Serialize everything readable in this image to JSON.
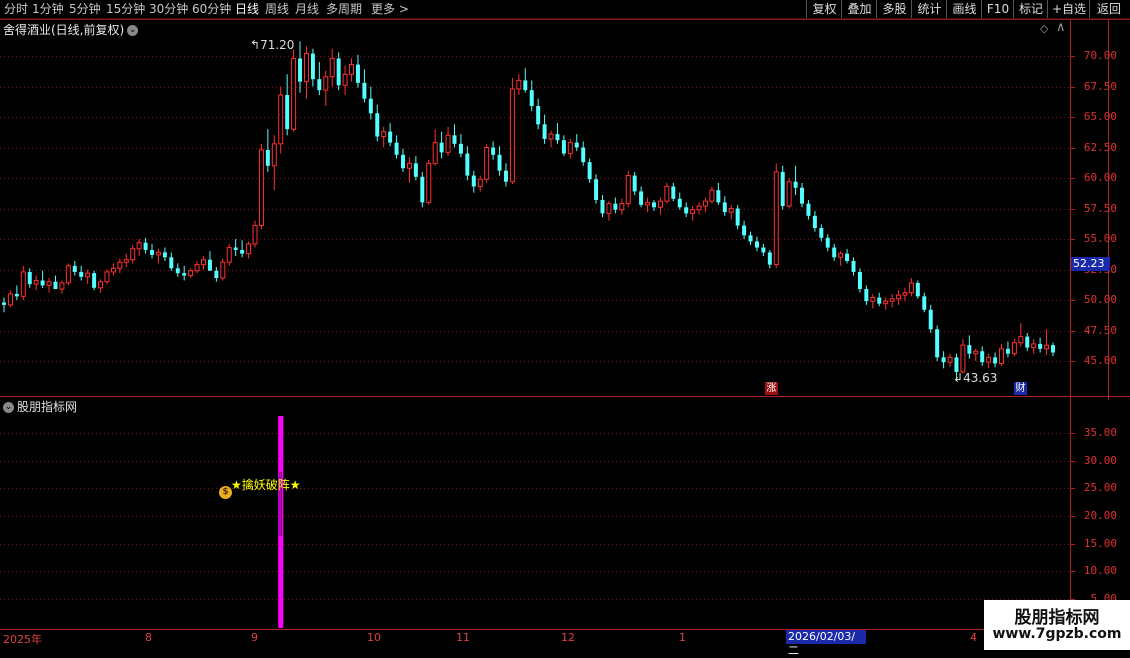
{
  "toolbar": {
    "periods": [
      "分时",
      "1分钟",
      "5分钟",
      "15分钟",
      "30分钟",
      "60分钟",
      "日线",
      "周线",
      "月线",
      "多周期",
      "更多"
    ],
    "active_period": "日线",
    "buttons": [
      "复权",
      "叠加",
      "多股",
      "统计",
      "画线",
      "F10",
      "标记",
      "+自选",
      "返回"
    ]
  },
  "main_chart": {
    "title": "舍得酒业(日线,前复权)",
    "price_labels": [
      "70.00",
      "67.50",
      "65.00",
      "62.50",
      "60.00",
      "57.50",
      "55.00",
      "52.50",
      "50.00",
      "47.50",
      "45.00"
    ],
    "current_price_tag": "52.23",
    "high_annotation": "71.20",
    "low_annotation": "43.63",
    "event_markers": [
      "涨",
      "财"
    ]
  },
  "indicator_panel": {
    "title": "股朋指标网",
    "signal_text": "★擒妖破阵★",
    "axis_labels": [
      "35.00",
      "30.00",
      "25.00",
      "20.00",
      "15.00",
      "10.00",
      "5.00"
    ]
  },
  "date_axis": {
    "labels": [
      "2025年",
      "8",
      "9",
      "10",
      "11",
      "12",
      "1",
      "4"
    ],
    "highlighted_date": "2026/02/03/二"
  },
  "watermark": {
    "name": "股朋指标网",
    "url": "www.7gpzb.com"
  },
  "colors": {
    "up": "#ff3030",
    "down": "#54ffff",
    "grid": "#7a1010",
    "signal_bar": "#ff00ff",
    "signal_text": "#ffff00"
  },
  "chart_data": {
    "type": "candlestick",
    "ylim": [
      43.0,
      72.5
    ],
    "candles": [
      [
        49.8,
        50.2,
        49.0,
        49.6
      ],
      [
        49.6,
        50.8,
        49.4,
        50.5
      ],
      [
        50.5,
        51.2,
        50.0,
        50.3
      ],
      [
        50.3,
        52.8,
        50.0,
        52.3
      ],
      [
        52.3,
        52.6,
        51.0,
        51.3
      ],
      [
        51.3,
        52.0,
        50.8,
        51.6
      ],
      [
        51.6,
        52.4,
        51.0,
        51.2
      ],
      [
        51.2,
        51.8,
        50.6,
        51.5
      ],
      [
        51.5,
        52.0,
        51.0,
        50.9
      ],
      [
        50.9,
        51.6,
        50.5,
        51.4
      ],
      [
        51.4,
        53.0,
        51.2,
        52.8
      ],
      [
        52.8,
        53.2,
        52.0,
        52.3
      ],
      [
        52.3,
        52.8,
        51.6,
        51.9
      ],
      [
        51.9,
        52.5,
        51.3,
        52.2
      ],
      [
        52.2,
        52.4,
        50.8,
        51.0
      ],
      [
        51.0,
        51.7,
        50.6,
        51.5
      ],
      [
        51.5,
        52.5,
        51.3,
        52.3
      ],
      [
        52.3,
        53.0,
        52.0,
        52.6
      ],
      [
        52.6,
        53.4,
        52.2,
        53.1
      ],
      [
        53.1,
        53.8,
        52.7,
        53.3
      ],
      [
        53.3,
        54.5,
        53.0,
        54.2
      ],
      [
        54.2,
        55.0,
        53.6,
        54.7
      ],
      [
        54.7,
        55.1,
        53.8,
        54.1
      ],
      [
        54.1,
        54.6,
        53.4,
        53.7
      ],
      [
        53.7,
        54.2,
        53.0,
        53.9
      ],
      [
        53.9,
        54.3,
        53.2,
        53.5
      ],
      [
        53.5,
        53.9,
        52.4,
        52.6
      ],
      [
        52.6,
        53.0,
        51.9,
        52.2
      ],
      [
        52.2,
        52.8,
        51.6,
        52.0
      ],
      [
        52.0,
        52.6,
        51.8,
        52.4
      ],
      [
        52.4,
        53.2,
        52.2,
        52.9
      ],
      [
        52.9,
        53.6,
        52.5,
        53.3
      ],
      [
        53.3,
        54.0,
        52.9,
        52.4
      ],
      [
        52.4,
        52.7,
        51.5,
        51.8
      ],
      [
        51.8,
        53.4,
        51.6,
        53.1
      ],
      [
        53.1,
        54.6,
        52.8,
        54.3
      ],
      [
        54.3,
        55.0,
        53.6,
        54.1
      ],
      [
        54.1,
        54.9,
        53.5,
        53.8
      ],
      [
        53.8,
        54.8,
        53.4,
        54.6
      ],
      [
        54.6,
        56.5,
        54.3,
        56.1
      ],
      [
        56.1,
        62.8,
        55.8,
        62.3
      ],
      [
        62.3,
        64.0,
        60.5,
        61.0
      ],
      [
        61.0,
        63.5,
        59.0,
        62.8
      ],
      [
        62.8,
        67.5,
        62.0,
        66.8
      ],
      [
        66.8,
        68.5,
        63.5,
        64.0
      ],
      [
        64.0,
        70.5,
        63.8,
        69.8
      ],
      [
        69.8,
        71.2,
        67.0,
        67.9
      ],
      [
        67.9,
        70.8,
        66.5,
        70.2
      ],
      [
        70.2,
        70.6,
        67.5,
        68.1
      ],
      [
        68.1,
        69.5,
        66.8,
        67.2
      ],
      [
        67.2,
        68.8,
        65.9,
        68.3
      ],
      [
        68.3,
        70.6,
        67.5,
        69.8
      ],
      [
        69.8,
        70.3,
        67.2,
        67.6
      ],
      [
        67.6,
        69.2,
        66.8,
        68.5
      ],
      [
        68.5,
        69.8,
        67.9,
        69.3
      ],
      [
        69.3,
        70.1,
        67.4,
        67.8
      ],
      [
        67.8,
        68.9,
        66.2,
        66.5
      ],
      [
        66.5,
        67.5,
        64.8,
        65.3
      ],
      [
        65.3,
        66.0,
        63.0,
        63.4
      ],
      [
        63.4,
        64.2,
        62.5,
        63.8
      ],
      [
        63.8,
        64.5,
        62.6,
        62.9
      ],
      [
        62.9,
        63.5,
        61.6,
        61.9
      ],
      [
        61.9,
        62.4,
        60.5,
        60.8
      ],
      [
        60.8,
        61.7,
        59.6,
        61.2
      ],
      [
        61.2,
        61.8,
        59.8,
        60.1
      ],
      [
        60.1,
        60.5,
        57.6,
        58.0
      ],
      [
        58.0,
        61.5,
        57.8,
        61.2
      ],
      [
        61.2,
        64.0,
        61.0,
        62.9
      ],
      [
        62.9,
        63.8,
        61.6,
        62.1
      ],
      [
        62.1,
        64.2,
        61.8,
        63.5
      ],
      [
        63.5,
        64.4,
        62.5,
        62.8
      ],
      [
        62.8,
        63.6,
        61.7,
        62.0
      ],
      [
        62.0,
        62.6,
        59.8,
        60.2
      ],
      [
        60.2,
        60.6,
        58.8,
        59.3
      ],
      [
        59.3,
        60.2,
        58.9,
        59.9
      ],
      [
        59.9,
        62.8,
        59.6,
        62.5
      ],
      [
        62.5,
        63.0,
        61.5,
        61.9
      ],
      [
        61.9,
        62.6,
        60.2,
        60.6
      ],
      [
        60.6,
        61.2,
        59.3,
        59.7
      ],
      [
        59.7,
        68.2,
        59.5,
        67.3
      ],
      [
        67.3,
        68.5,
        66.8,
        68.0
      ],
      [
        68.0,
        69.0,
        67.0,
        67.2
      ],
      [
        67.2,
        68.0,
        65.5,
        65.9
      ],
      [
        65.9,
        66.5,
        64.0,
        64.4
      ],
      [
        64.4,
        65.2,
        62.8,
        63.2
      ],
      [
        63.2,
        63.9,
        62.5,
        63.6
      ],
      [
        63.6,
        64.5,
        62.8,
        63.1
      ],
      [
        63.1,
        63.5,
        61.8,
        62.0
      ],
      [
        62.0,
        63.2,
        61.6,
        62.9
      ],
      [
        62.9,
        63.6,
        62.2,
        62.5
      ],
      [
        62.5,
        63.0,
        61.0,
        61.3
      ],
      [
        61.3,
        61.6,
        59.6,
        59.9
      ],
      [
        59.9,
        60.3,
        57.9,
        58.2
      ],
      [
        58.2,
        58.6,
        56.8,
        57.1
      ],
      [
        57.1,
        58.1,
        56.5,
        57.9
      ],
      [
        57.9,
        58.4,
        57.1,
        57.4
      ],
      [
        57.4,
        58.3,
        57.0,
        57.9
      ],
      [
        57.9,
        60.6,
        57.6,
        60.2
      ],
      [
        60.2,
        60.5,
        58.6,
        58.9
      ],
      [
        58.9,
        59.3,
        57.6,
        57.8
      ],
      [
        57.8,
        58.4,
        57.2,
        58.0
      ],
      [
        58.0,
        58.2,
        57.3,
        57.6
      ],
      [
        57.6,
        58.4,
        57.0,
        58.1
      ],
      [
        58.1,
        59.6,
        57.9,
        59.3
      ],
      [
        59.3,
        59.6,
        58.1,
        58.3
      ],
      [
        58.3,
        58.8,
        57.4,
        57.6
      ],
      [
        57.6,
        58.0,
        56.8,
        57.1
      ],
      [
        57.1,
        57.7,
        56.5,
        57.4
      ],
      [
        57.4,
        58.0,
        57.0,
        57.7
      ],
      [
        57.7,
        58.4,
        57.2,
        58.1
      ],
      [
        58.1,
        59.3,
        57.9,
        59.0
      ],
      [
        59.0,
        59.6,
        57.8,
        58.0
      ],
      [
        58.0,
        58.5,
        56.9,
        57.2
      ],
      [
        57.2,
        57.8,
        56.6,
        57.5
      ],
      [
        57.5,
        57.8,
        55.8,
        56.1
      ],
      [
        56.1,
        56.5,
        55.0,
        55.3
      ],
      [
        55.3,
        55.6,
        54.5,
        54.8
      ],
      [
        54.8,
        55.2,
        54.0,
        54.3
      ],
      [
        54.3,
        54.6,
        53.6,
        53.9
      ],
      [
        53.9,
        54.1,
        52.6,
        52.9
      ],
      [
        52.9,
        61.2,
        52.6,
        60.5
      ],
      [
        60.5,
        61.0,
        57.4,
        57.7
      ],
      [
        57.7,
        60.0,
        57.5,
        59.7
      ],
      [
        59.7,
        61.0,
        58.6,
        59.2
      ],
      [
        59.2,
        59.6,
        57.6,
        57.9
      ],
      [
        57.9,
        58.2,
        56.6,
        56.9
      ],
      [
        56.9,
        57.3,
        55.6,
        55.9
      ],
      [
        55.9,
        56.2,
        54.8,
        55.1
      ],
      [
        55.1,
        55.4,
        54.0,
        54.3
      ],
      [
        54.3,
        54.6,
        53.2,
        53.5
      ],
      [
        53.5,
        54.0,
        52.8,
        53.8
      ],
      [
        53.8,
        54.2,
        53.0,
        53.2
      ],
      [
        53.2,
        53.5,
        52.0,
        52.3
      ],
      [
        52.3,
        52.6,
        50.6,
        50.9
      ],
      [
        50.9,
        51.2,
        49.6,
        49.9
      ],
      [
        49.9,
        50.5,
        49.3,
        50.2
      ],
      [
        50.2,
        50.6,
        49.5,
        49.7
      ],
      [
        49.7,
        50.2,
        49.2,
        49.9
      ],
      [
        49.9,
        50.5,
        49.4,
        50.1
      ],
      [
        50.1,
        50.8,
        49.6,
        50.4
      ],
      [
        50.4,
        51.0,
        49.9,
        50.6
      ],
      [
        50.6,
        51.8,
        50.3,
        51.4
      ],
      [
        51.4,
        51.6,
        50.1,
        50.3
      ],
      [
        50.3,
        50.6,
        49.0,
        49.2
      ],
      [
        49.2,
        49.6,
        47.3,
        47.6
      ],
      [
        47.6,
        47.9,
        45.0,
        45.3
      ],
      [
        45.3,
        45.8,
        44.4,
        44.9
      ],
      [
        44.9,
        45.6,
        44.5,
        45.3
      ],
      [
        45.3,
        45.6,
        43.63,
        44.1
      ],
      [
        44.1,
        46.8,
        44.0,
        46.3
      ],
      [
        46.3,
        47.1,
        45.2,
        45.6
      ],
      [
        45.6,
        46.0,
        45.0,
        45.8
      ],
      [
        45.8,
        46.2,
        44.6,
        44.9
      ],
      [
        44.9,
        45.6,
        44.4,
        45.3
      ],
      [
        45.3,
        45.7,
        44.5,
        44.8
      ],
      [
        44.8,
        46.4,
        44.6,
        46.0
      ],
      [
        46.0,
        46.6,
        45.3,
        45.6
      ],
      [
        45.6,
        46.8,
        45.4,
        46.5
      ],
      [
        46.5,
        48.1,
        46.2,
        47.0
      ],
      [
        47.0,
        47.3,
        45.8,
        46.1
      ],
      [
        46.1,
        46.8,
        45.6,
        46.4
      ],
      [
        46.4,
        46.9,
        45.7,
        46.0
      ],
      [
        46.0,
        47.6,
        45.5,
        46.3
      ],
      [
        46.3,
        46.5,
        45.4,
        45.7
      ]
    ],
    "signal_index": 43,
    "signal_value": 24.5,
    "indicator_ylim": [
      4.0,
      40.0
    ]
  }
}
